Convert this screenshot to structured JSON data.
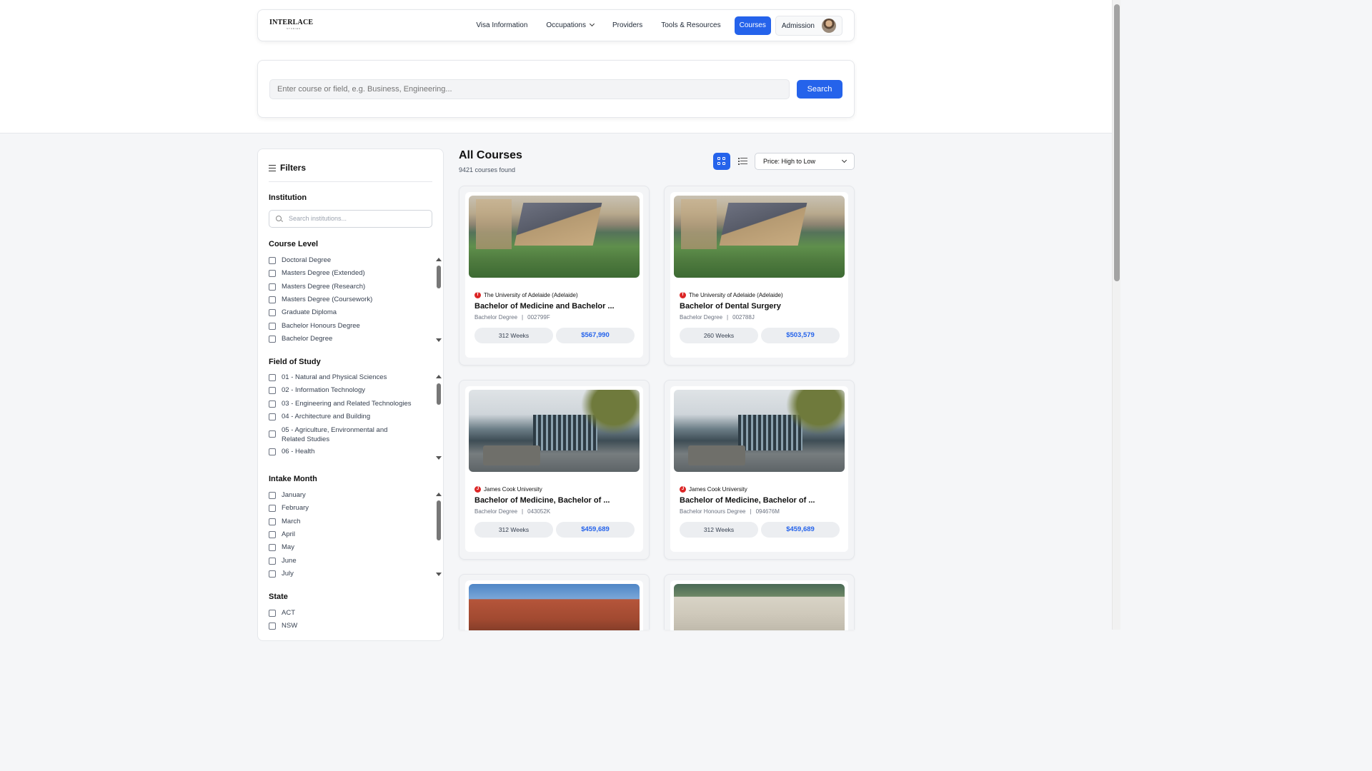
{
  "nav": {
    "logo": "INTERLACE",
    "logo_sub": "STUDIES",
    "items": [
      "Visa Information",
      "Occupations",
      "Providers",
      "Tools & Resources",
      "Courses"
    ],
    "admission": "Admission"
  },
  "search": {
    "placeholder": "Enter course or field, e.g. Business, Engineering...",
    "button": "Search"
  },
  "filters": {
    "title": "Filters",
    "institution": {
      "title": "Institution",
      "placeholder": "Search institutions..."
    },
    "course_level": {
      "title": "Course Level",
      "options": [
        "Doctoral Degree",
        "Masters Degree (Extended)",
        "Masters Degree (Research)",
        "Masters Degree (Coursework)",
        "Graduate Diploma",
        "Bachelor Honours Degree",
        "Bachelor Degree"
      ]
    },
    "field_of_study": {
      "title": "Field of Study",
      "options": [
        "01 - Natural and Physical Sciences",
        "02 - Information Technology",
        "03 - Engineering and Related Technologies",
        "04 - Architecture and Building",
        "05 - Agriculture, Environmental and Related Studies",
        "06 - Health"
      ]
    },
    "intake_month": {
      "title": "Intake Month",
      "options": [
        "January",
        "February",
        "March",
        "April",
        "May",
        "June",
        "July"
      ]
    },
    "state": {
      "title": "State",
      "options": [
        "ACT",
        "NSW"
      ]
    }
  },
  "main": {
    "title": "All Courses",
    "count": "9421 courses found",
    "sort": "Price: High to Low"
  },
  "courses": [
    {
      "badge": "T",
      "university": "The University of Adelaide (Adelaide)",
      "title": "Bachelor of Medicine and Bachelor ...",
      "level": "Bachelor Degree",
      "code": "002799F",
      "weeks": "312 Weeks",
      "price": "$567,990"
    },
    {
      "badge": "T",
      "university": "The University of Adelaide (Adelaide)",
      "title": "Bachelor of Dental Surgery",
      "level": "Bachelor Degree",
      "code": "002788J",
      "weeks": "260 Weeks",
      "price": "$503,579"
    },
    {
      "badge": "J",
      "university": "James Cook University",
      "title": "Bachelor of Medicine, Bachelor of ...",
      "level": "Bachelor Degree",
      "code": "043052K",
      "weeks": "312 Weeks",
      "price": "$459,689"
    },
    {
      "badge": "J",
      "university": "James Cook University",
      "title": "Bachelor of Medicine, Bachelor of ...",
      "level": "Bachelor Honours Degree",
      "code": "094676M",
      "weeks": "312 Weeks",
      "price": "$459,689"
    }
  ]
}
